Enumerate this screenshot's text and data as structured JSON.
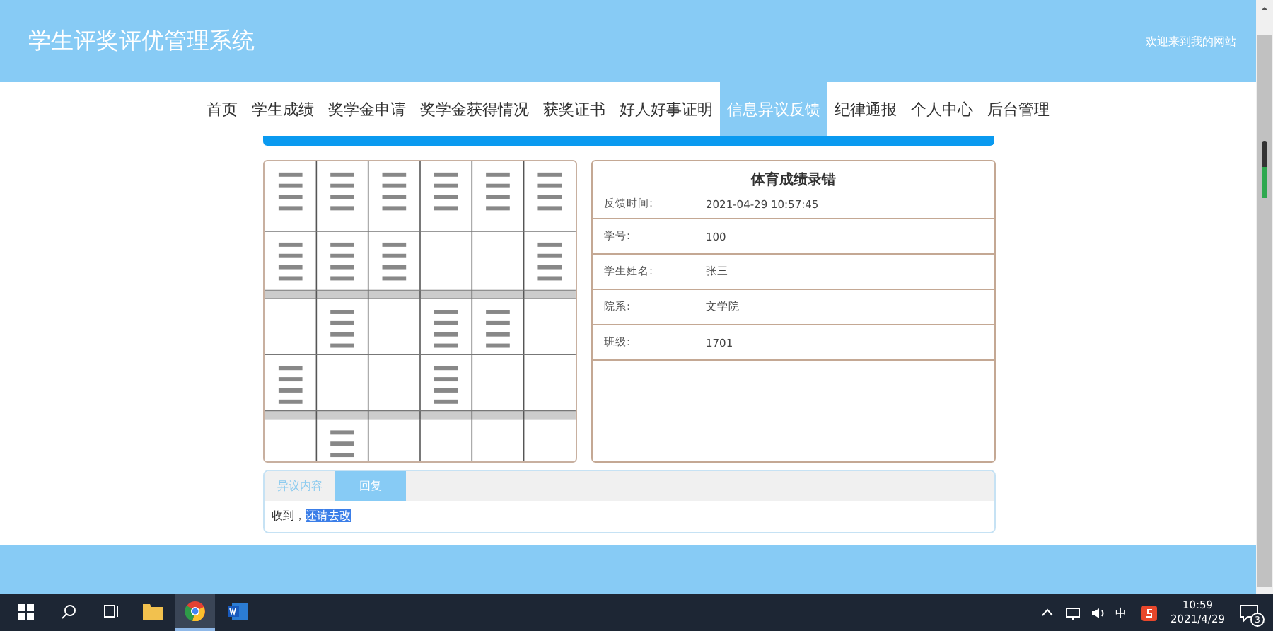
{
  "header": {
    "title": "学生评奖评优管理系统",
    "welcome": "欢迎来到我的网站"
  },
  "nav": [
    {
      "label": "首页",
      "selected": false
    },
    {
      "label": "学生成绩",
      "selected": false
    },
    {
      "label": "奖学金申请",
      "selected": false
    },
    {
      "label": "奖学金获得情况",
      "selected": false
    },
    {
      "label": "获奖证书",
      "selected": false
    },
    {
      "label": "好人好事证明",
      "selected": false
    },
    {
      "label": "信息异议反馈",
      "selected": true
    },
    {
      "label": "纪律通报",
      "selected": false
    },
    {
      "label": "个人中心",
      "selected": false
    },
    {
      "label": "后台管理",
      "selected": false
    }
  ],
  "detail": {
    "title": "体育成绩录错",
    "fields": [
      {
        "label": "反馈时间:",
        "value": "2021-04-29 10:57:45"
      },
      {
        "label": "学号:",
        "value": "100"
      },
      {
        "label": "学生姓名:",
        "value": "张三"
      },
      {
        "label": "院系:",
        "value": "文学院"
      },
      {
        "label": "班级:",
        "value": "1701"
      }
    ]
  },
  "tabs": [
    {
      "label": "异议内容",
      "selected": false
    },
    {
      "label": "回复",
      "selected": true
    }
  ],
  "reply": {
    "text": "收到，",
    "highlighted": "还请去改"
  },
  "taskbar": {
    "apps": [
      {
        "kind": "folder",
        "selected": false
      },
      {
        "kind": "browser",
        "selected": true
      },
      {
        "kind": "word",
        "selected": false
      }
    ],
    "ime": "中",
    "time": "10:59",
    "date": "2021/4/29",
    "notifications": "3"
  }
}
